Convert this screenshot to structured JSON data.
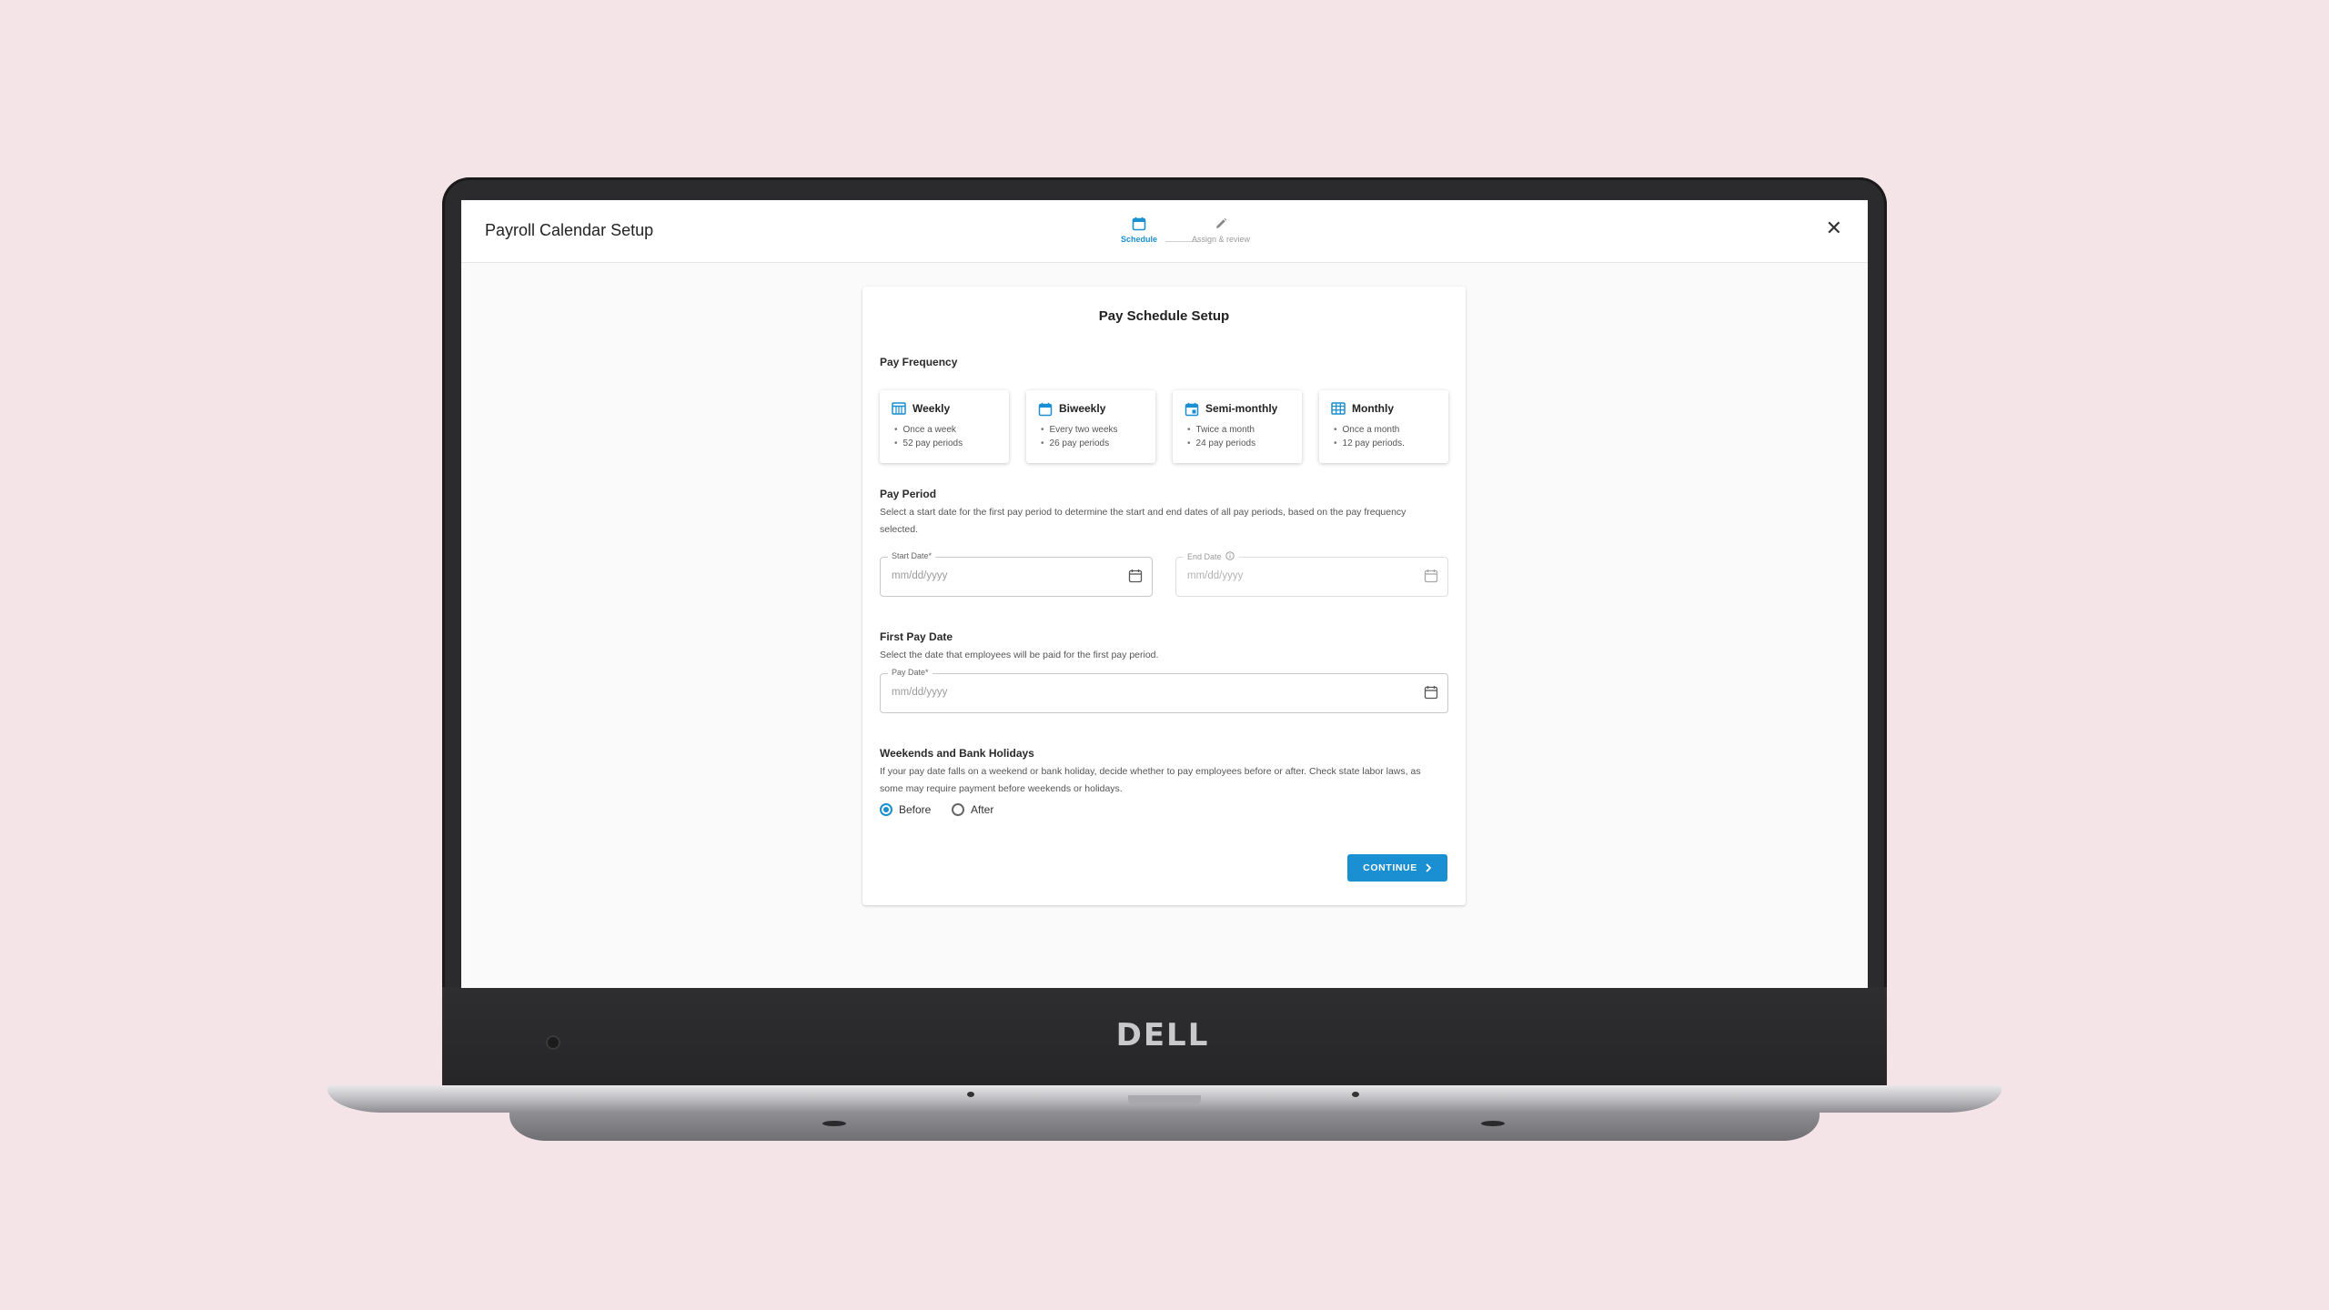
{
  "device": {
    "brand": "DELL"
  },
  "header": {
    "title": "Payroll Calendar Setup",
    "close_label": "✕",
    "steps": [
      {
        "label": "Schedule",
        "icon": "calendar-icon",
        "active": true
      },
      {
        "label": "Assign & review",
        "icon": "pencil-icon",
        "active": false
      }
    ]
  },
  "card": {
    "title": "Pay Schedule Setup",
    "pay_frequency": {
      "title": "Pay Frequency",
      "options": [
        {
          "name": "Weekly",
          "icon": "calendar-week-icon",
          "lines": [
            "Once a week",
            "52 pay periods"
          ]
        },
        {
          "name": "Biweekly",
          "icon": "calendar-icon",
          "lines": [
            "Every two weeks",
            "26 pay periods"
          ]
        },
        {
          "name": "Semi-monthly",
          "icon": "calendar-day-icon",
          "lines": [
            "Twice a month",
            "24 pay periods"
          ]
        },
        {
          "name": "Monthly",
          "icon": "calendar-month-icon",
          "lines": [
            "Once a month",
            "12 pay periods."
          ]
        }
      ]
    },
    "pay_period": {
      "title": "Pay Period",
      "description": "Select a start date for the first pay period to determine the start and end dates of all pay periods, based on the pay frequency selected.",
      "start_label": "Start Date*",
      "start_placeholder": "mm/dd/yyyy",
      "end_label": "End Date",
      "end_placeholder": "mm/dd/yyyy"
    },
    "first_pay_date": {
      "title": "First Pay Date",
      "description": "Select the date that employees will be paid for the first pay period.",
      "label": "Pay Date*",
      "placeholder": "mm/dd/yyyy"
    },
    "holidays": {
      "title": "Weekends and Bank Holidays",
      "description": "If your pay date falls on a weekend or bank holiday, decide whether to pay employees before or after. Check state labor laws, as some may require payment before weekends or holidays.",
      "options": [
        "Before",
        "After"
      ],
      "selected": "Before"
    },
    "continue_label": "CONTINUE"
  },
  "colors": {
    "accent": "#1a8fd1",
    "background": "#f4e4e8"
  }
}
